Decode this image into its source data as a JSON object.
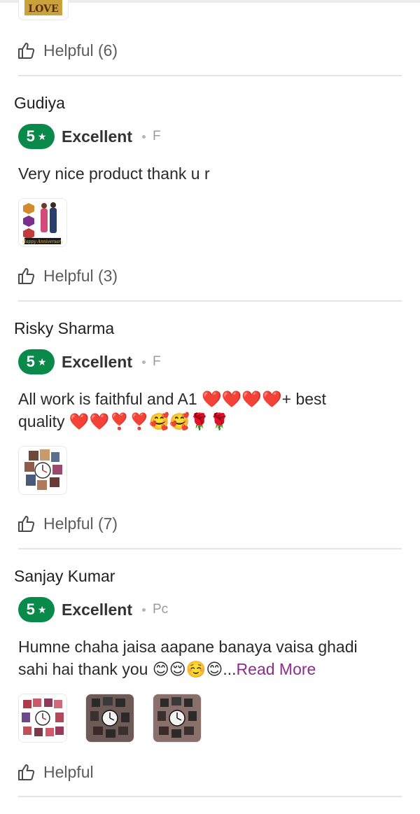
{
  "helpful_icon": "thumbs-up-icon",
  "star_icon": "star-icon",
  "colors": {
    "badge": "#0a8a4a",
    "read_more": "#8e2d8e",
    "divider": "#e4e4e4"
  },
  "top_partial": {
    "image_label": "LOVE",
    "helpful_label": "Helpful (6)"
  },
  "reviews": [
    {
      "name": "Gudiya",
      "rating": "5",
      "rating_label": "Excellent",
      "posted_partial": "F",
      "text": "Very nice product thank u r",
      "helpful_label": "Helpful (3)",
      "image_caption": "Happy Anniversary"
    },
    {
      "name": "Risky Sharma",
      "rating": "5",
      "rating_label": "Excellent",
      "posted_partial": "F",
      "text_line1": "All work is faithful and A1 ❤️❤️❤️❤️+ best",
      "text_line2": "quality ❤️❤️❣️❣️🥰🥰🌹🌹",
      "helpful_label": "Helpful (7)"
    },
    {
      "name": "Sanjay Kumar",
      "rating": "5",
      "rating_label": "Excellent",
      "posted_partial": "Pc",
      "text_line1": "Humne chaha jaisa aapane banaya vaisa ghadi",
      "text_line2": "sahi hai thank you 😊😌☺️😊...",
      "read_more": "Read More",
      "helpful_label": "Helpful"
    }
  ]
}
